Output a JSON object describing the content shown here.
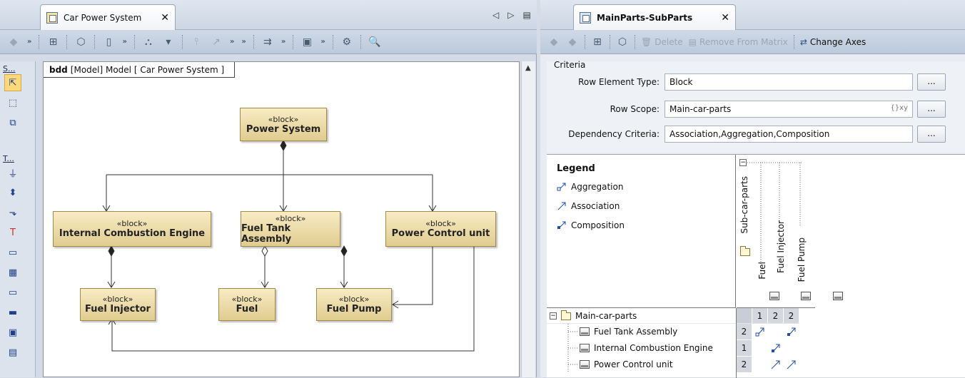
{
  "left_tab": {
    "title": "Car Power System",
    "close": "✕",
    "prev": "◁",
    "next": "▷",
    "menu": "▤"
  },
  "left_toolbar": {
    "items": [
      {
        "name": "back-arrow-icon",
        "glyph": "◆"
      },
      {
        "name": "more-1",
        "glyph": "»"
      },
      {
        "name": "containment-tree-icon",
        "glyph": "⊞"
      },
      {
        "name": "specification-icon",
        "glyph": "⬡"
      },
      {
        "name": "paste-icon",
        "glyph": "▯"
      },
      {
        "name": "more-2",
        "glyph": "»"
      },
      {
        "name": "layout-icon",
        "glyph": "⛬"
      },
      {
        "name": "layout-dropdown-icon",
        "glyph": "▾"
      },
      {
        "name": "relation-icon",
        "glyph": "⫯"
      },
      {
        "name": "path-icon",
        "glyph": "↗"
      },
      {
        "name": "more-3",
        "glyph": "»"
      },
      {
        "name": "more-4",
        "glyph": "»"
      },
      {
        "name": "route-icon",
        "glyph": "⇉"
      },
      {
        "name": "more-5",
        "glyph": "»"
      },
      {
        "name": "display-icon",
        "glyph": "▣"
      },
      {
        "name": "more-6",
        "glyph": "»"
      },
      {
        "name": "gear-icon",
        "glyph": "⚙"
      },
      {
        "name": "zoom-icon",
        "glyph": "🔍"
      }
    ]
  },
  "palette": {
    "headers": [
      "S...",
      "T..."
    ],
    "items": [
      "⇱",
      "⬚",
      "⧉",
      "⏚",
      "⬍",
      "⬎",
      "T",
      "▭",
      "▦",
      "▭",
      "▬",
      "▣",
      "▤"
    ]
  },
  "diagram": {
    "kind": "bdd",
    "frame_text": "[Model] Model [ Car Power System ]",
    "blocks": [
      {
        "id": "power-system",
        "stereotype": "«block»",
        "name": "Power System"
      },
      {
        "id": "ice",
        "stereotype": "«block»",
        "name": "Internal Combustion Engine"
      },
      {
        "id": "fta",
        "stereotype": "«block»",
        "name": "Fuel Tank Assembly"
      },
      {
        "id": "pcu",
        "stereotype": "«block»",
        "name": "Power Control unit"
      },
      {
        "id": "injector",
        "stereotype": "«block»",
        "name": "Fuel Injector"
      },
      {
        "id": "fuel",
        "stereotype": "«block»",
        "name": "Fuel"
      },
      {
        "id": "pump",
        "stereotype": "«block»",
        "name": "Fuel Pump"
      }
    ]
  },
  "right_tab": {
    "title": "MainParts-SubParts",
    "close": "✕"
  },
  "right_toolbar": {
    "delete": "Delete",
    "remove": "Remove From Matrix",
    "change_axes": "Change Axes"
  },
  "criteria": {
    "heading": "Criteria",
    "row_type_label": "Row Element Type:",
    "row_type_value": "Block",
    "row_scope_label": "Row Scope:",
    "row_scope_value": "Main-car-parts",
    "row_scope_icon": "{}xy",
    "dep_label": "Dependency Criteria:",
    "dep_value": "Association,Aggregation,Composition",
    "ellipsis": "..."
  },
  "legend": {
    "title": "Legend",
    "items": [
      "Aggregation",
      "Association",
      "Composition"
    ]
  },
  "matrix": {
    "column_group": "Sub-car-parts",
    "columns": [
      {
        "name": "Fuel",
        "count": "1"
      },
      {
        "name": "Fuel Injector",
        "count": "2"
      },
      {
        "name": "Fuel Pump",
        "count": "2"
      }
    ],
    "row_group": "Main-car-parts",
    "rows": [
      {
        "name": "Fuel Tank Assembly",
        "count": "2",
        "cells": [
          "aggregation",
          "",
          "composition"
        ]
      },
      {
        "name": "Internal Combustion Engine",
        "count": "1",
        "cells": [
          "",
          "composition",
          ""
        ]
      },
      {
        "name": "Power Control unit",
        "count": "2",
        "cells": [
          "",
          "association",
          "association"
        ]
      }
    ]
  },
  "colors": {
    "block_fill_top": "#f8ecc4",
    "block_fill_bottom": "#e0cc90",
    "dependency_blue": "#1f4fb0"
  }
}
